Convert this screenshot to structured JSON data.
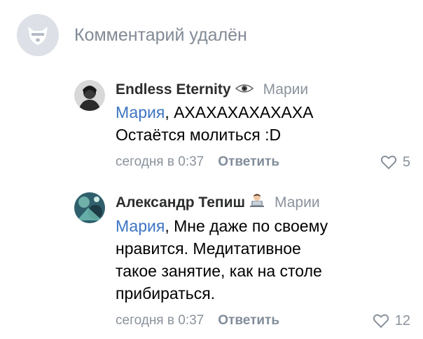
{
  "deleted_comment": {
    "text": "Комментарий удалён",
    "icon": "dog-avatar-icon"
  },
  "comments": [
    {
      "author": "Endless Eternity",
      "author_badge": "eye-emoji",
      "reply_to": "Марии",
      "mention": "Мария",
      "text_after_mention": ", АХАХАХАХАХАХА",
      "text_line2": "Остаётся молиться :D",
      "time": "сегодня в 0:37",
      "reply_label": "Ответить",
      "likes": "5"
    },
    {
      "author": "Александр Тепиш",
      "author_badge": "technologist-emoji",
      "reply_to": "Марии",
      "mention": "Мария",
      "text_after_mention": ", Мне даже по своему",
      "text_line2": "нравится. Медитативное",
      "text_line3": "такое занятие, как на столе",
      "text_line4": "прибираться.",
      "time": "сегодня в 0:37",
      "reply_label": "Ответить",
      "likes": "12"
    }
  ],
  "colors": {
    "mention": "#3d74c2",
    "muted": "#8a929c",
    "author": "#2c2d2e"
  }
}
